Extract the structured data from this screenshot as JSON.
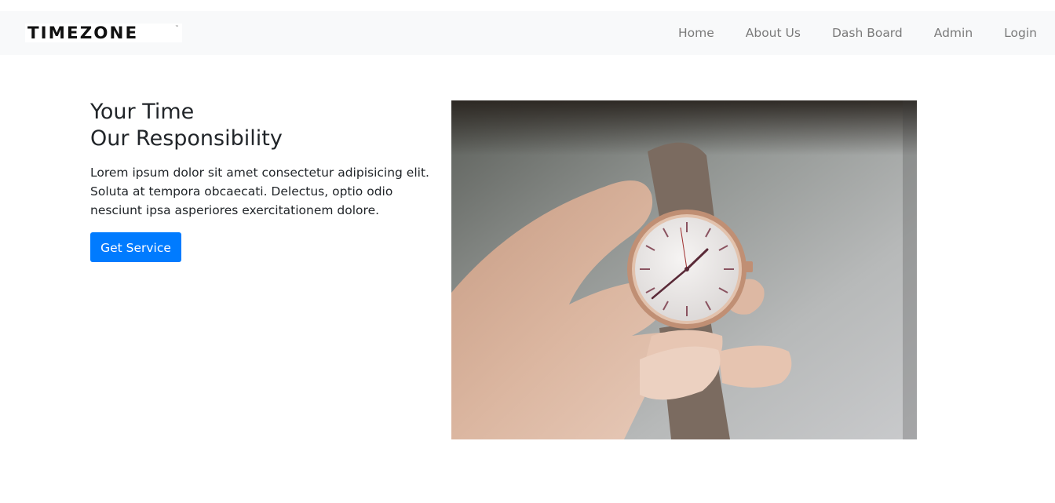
{
  "navbar": {
    "logo_text": "TIMEZONE",
    "logo_tm": "™",
    "links": [
      "Home",
      "About Us",
      "Dash Board",
      "Admin",
      "Login"
    ]
  },
  "hero": {
    "headline_line1": "Your Time",
    "headline_line2": "Our Responsibility",
    "description": "Lorem ipsum dolor sit amet consectetur adipisicing elit. Soluta at tempora obcaecati. Delectus, optio odio nesciunt ipsa asperiores exercitationem dolore.",
    "button_label": "Get Service"
  },
  "colors": {
    "navbar_bg": "#f8f9fa",
    "nav_link": "#7a7a7a",
    "primary_button": "#007bff",
    "text": "#212529"
  },
  "icons": {
    "hero_image": "wristwatch-in-hand-photo"
  }
}
